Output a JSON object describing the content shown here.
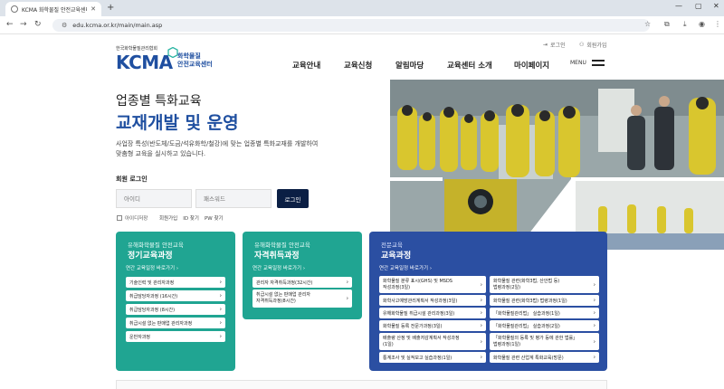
{
  "browser": {
    "tab_title": "KCMA 화학물질 안전교육센터",
    "url": "edu.kcma.or.kr/main/main.asp"
  },
  "header": {
    "util": {
      "login": "로그인",
      "join": "회원가입"
    },
    "logo": {
      "association": "한국화학물질관리협회",
      "kcma": "KCMA",
      "center_line1": "화학물질",
      "center_line2": "안전교육센터"
    },
    "nav": [
      "교육안내",
      "교육신청",
      "알림마당",
      "교육센터 소개",
      "마이페이지"
    ],
    "menu_label": "MENU"
  },
  "hero": {
    "eyebrow": "업종별 특화교육",
    "title": "교재개발 및 운영",
    "desc_line1": "사업장 특성(반도체/도금/석유화학/철강)에 맞는 업종별 특화교재를 개발하여",
    "desc_line2": "맞춤형 교육을 실시하고 있습니다."
  },
  "login": {
    "title": "회원 로그인",
    "id_placeholder": "아이디",
    "pw_placeholder": "패스워드",
    "button": "로그인",
    "remember": "아이디저장",
    "links": [
      "회원가입",
      "ID 찾기",
      "PW 찾기"
    ]
  },
  "cards": [
    {
      "sub": "유해화학물질 안전교육",
      "title": "정기교육과정",
      "link": "연간 교육일정 바로가기",
      "courses": [
        "기술인력 및 관리자과정",
        "취급담당자과정 (16시간)",
        "취급담당자과정 (8시간)",
        "취급시설 없는 판매업 관리자과정",
        "운반자과정"
      ]
    },
    {
      "sub": "유해화학물질 안전교육",
      "title": "자격취득과정",
      "link": "연간 교육일정 바로가기",
      "courses": [
        "관리자 자격취득과정(32시간)",
        "취급시설 없는 판매업 관리자",
        "자격취득과정(8시간)"
      ]
    },
    {
      "sub": "전문교육",
      "title": "교육과정",
      "link": "연간 교육일정 바로가기",
      "left_courses": [
        "화학물질 분류 표시(GHS) 및 MSDS",
        "작성과정(3일)",
        "화학사고예방관리계획서 작성과정(3일)",
        "유해화학물질 취급시설 관리과정(3일)",
        "화학물질 등록 전문가과정(3일)",
        "배출량 산정 및 배출저감계획서 작성과정",
        "(1일)",
        "통계조사 및 실적보고 실습과정(1일)"
      ],
      "right_courses": [
        "화학물질 관련(화학3법, 산안법 등)",
        "법령과정(2일)",
        "화학물질 관련(화학3법) 법령과정(1일)",
        "「화학물질관리법」 실습과정(1일)",
        "「화학물질관리법」 실습과정(2일)",
        "「화학물질의 등록 및 평가 등에 관한 법률」",
        "법령과정(1일)",
        "화학물질 관련 산업계 특화교육(방문)"
      ]
    }
  ],
  "chevron": "›",
  "arrow": "›"
}
